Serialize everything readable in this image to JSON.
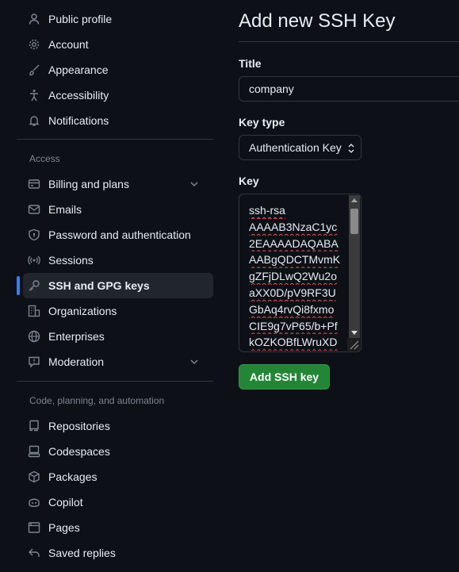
{
  "sidebar": {
    "group1": [
      {
        "label": "Public profile",
        "icon": "person-icon"
      },
      {
        "label": "Account",
        "icon": "gear-icon"
      },
      {
        "label": "Appearance",
        "icon": "paintbrush-icon"
      },
      {
        "label": "Accessibility",
        "icon": "accessibility-icon"
      },
      {
        "label": "Notifications",
        "icon": "bell-icon"
      }
    ],
    "access_title": "Access",
    "access": [
      {
        "label": "Billing and plans",
        "icon": "credit-card-icon",
        "expandable": true
      },
      {
        "label": "Emails",
        "icon": "mail-icon"
      },
      {
        "label": "Password and authentication",
        "icon": "shield-lock-icon"
      },
      {
        "label": "Sessions",
        "icon": "broadcast-icon"
      },
      {
        "label": "SSH and GPG keys",
        "icon": "key-icon",
        "active": true
      },
      {
        "label": "Organizations",
        "icon": "organization-icon"
      },
      {
        "label": "Enterprises",
        "icon": "globe-icon"
      },
      {
        "label": "Moderation",
        "icon": "report-icon",
        "expandable": true
      }
    ],
    "code_title": "Code, planning, and automation",
    "code": [
      {
        "label": "Repositories",
        "icon": "repo-icon"
      },
      {
        "label": "Codespaces",
        "icon": "codespaces-icon"
      },
      {
        "label": "Packages",
        "icon": "package-icon"
      },
      {
        "label": "Copilot",
        "icon": "copilot-icon"
      },
      {
        "label": "Pages",
        "icon": "browser-icon"
      },
      {
        "label": "Saved replies",
        "icon": "reply-icon"
      }
    ]
  },
  "main": {
    "title": "Add new SSH Key",
    "title_label": "Title",
    "title_value": "company",
    "key_type_label": "Key type",
    "key_type_value": "Authentication Key",
    "key_label": "Key",
    "key_lines": [
      "ssh-rsa",
      "AAAAB3NzaC1yc",
      "2EAAAADAQABA",
      "AABgQDCTMvmK",
      "gZFjDLwQ2Wu2o",
      "aXX0D/pV9RF3U",
      "GbAq4rvQi8fxmo",
      "CIE9g7vP65/b+Pf",
      "kOZKOBfLWruXD"
    ],
    "submit_label": "Add SSH key"
  },
  "colors": {
    "background": "#0d1117",
    "accent": "#2f81f7",
    "primary_button": "#238636",
    "muted_text": "#7d8590",
    "border": "#30363d"
  }
}
